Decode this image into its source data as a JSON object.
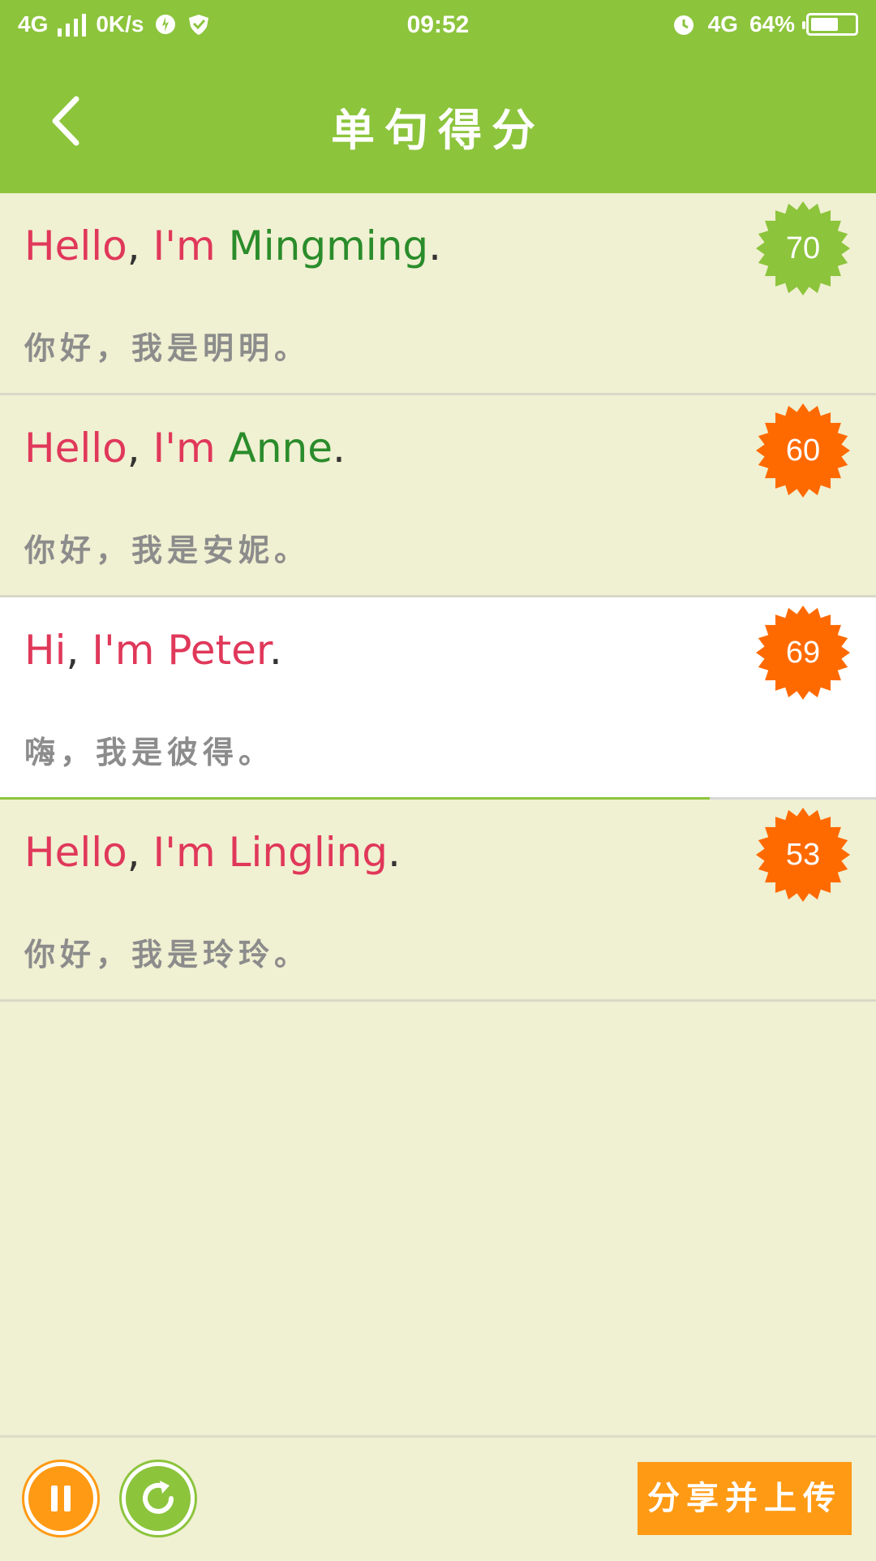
{
  "status_bar": {
    "network": "4G",
    "speed": "0K/s",
    "time": "09:52",
    "network_right": "4G",
    "battery": "64%",
    "battery_level": 0.64
  },
  "header": {
    "title": "单句得分",
    "back_icon": "chevron-left-icon"
  },
  "sentences": [
    {
      "en": [
        {
          "text": "Hello",
          "color": "#e0385a"
        },
        {
          "text": ", ",
          "color": "#333333"
        },
        {
          "text": "I'm",
          "color": "#e0385a"
        },
        {
          "text": " ",
          "color": "#333333"
        },
        {
          "text": "Mingming",
          "color": "#2a8c2a"
        },
        {
          "text": ".",
          "color": "#333333"
        }
      ],
      "zh": "你好，我是明明。",
      "score": "70",
      "badge_color": "#8cc43c",
      "selected": false
    },
    {
      "en": [
        {
          "text": "Hello",
          "color": "#e0385a"
        },
        {
          "text": ", ",
          "color": "#333333"
        },
        {
          "text": "I'm",
          "color": "#e0385a"
        },
        {
          "text": " ",
          "color": "#333333"
        },
        {
          "text": "Anne",
          "color": "#2a8c2a"
        },
        {
          "text": ".",
          "color": "#333333"
        }
      ],
      "zh": "你好，我是安妮。",
      "score": "60",
      "badge_color": "#ff6a00",
      "selected": false
    },
    {
      "en": [
        {
          "text": "Hi",
          "color": "#e0385a"
        },
        {
          "text": ", ",
          "color": "#333333"
        },
        {
          "text": "I'm",
          "color": "#e0385a"
        },
        {
          "text": " ",
          "color": "#333333"
        },
        {
          "text": "Peter",
          "color": "#e0385a"
        },
        {
          "text": ".",
          "color": "#333333"
        }
      ],
      "zh": "嗨，我是彼得。",
      "score": "69",
      "badge_color": "#ff6a00",
      "selected": true,
      "progress": 0.81
    },
    {
      "en": [
        {
          "text": "Hello",
          "color": "#e0385a"
        },
        {
          "text": ", ",
          "color": "#333333"
        },
        {
          "text": "I'm",
          "color": "#e0385a"
        },
        {
          "text": " ",
          "color": "#333333"
        },
        {
          "text": "Lingling",
          "color": "#e0385a"
        },
        {
          "text": ".",
          "color": "#333333"
        }
      ],
      "zh": "你好，我是玲玲。",
      "score": "53",
      "badge_color": "#ff6a00",
      "selected": false
    }
  ],
  "bottom": {
    "pause_icon": "pause-icon",
    "replay_icon": "replay-icon",
    "share_label": "分享并上传"
  },
  "colors": {
    "accent": "#8cc43c",
    "orange": "#ff9a14",
    "background": "#f0f0d2"
  }
}
